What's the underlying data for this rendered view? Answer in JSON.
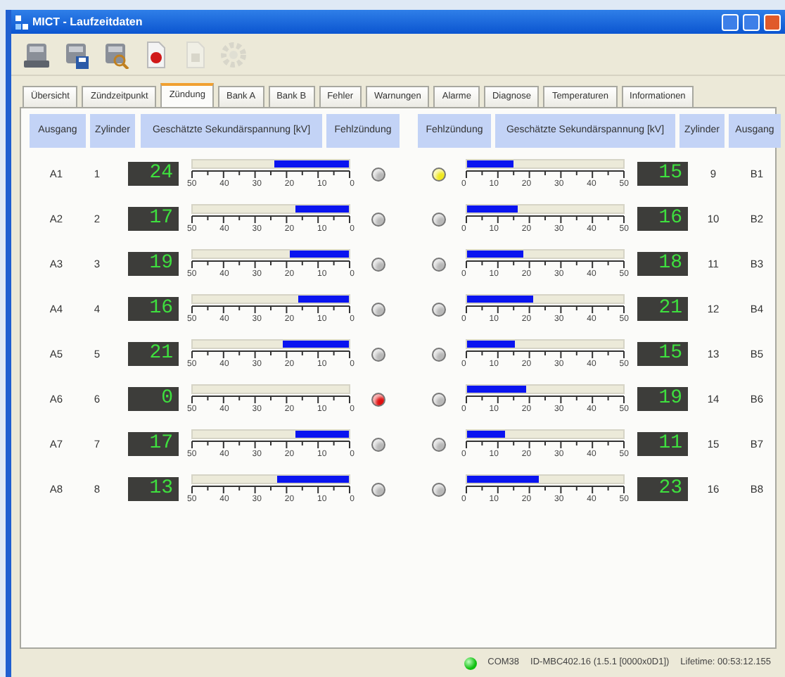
{
  "window": {
    "title": "MICT - Laufzeitdaten",
    "buttons": [
      {
        "kind": "minimize"
      },
      {
        "kind": "maximize"
      },
      {
        "kind": "close"
      }
    ]
  },
  "toolbar": [
    {
      "kind": "computer",
      "disabled": false
    },
    {
      "kind": "computer-save",
      "disabled": false
    },
    {
      "kind": "computer-search",
      "disabled": false
    },
    {
      "kind": "record",
      "disabled": false
    },
    {
      "kind": "stop",
      "disabled": true
    },
    {
      "kind": "gear",
      "disabled": true
    }
  ],
  "tabs": [
    {
      "label": "Übersicht",
      "selected": false
    },
    {
      "label": "Zündzeitpunkt",
      "selected": false
    },
    {
      "label": "Zündung",
      "selected": true
    },
    {
      "label": "Bank A",
      "selected": false
    },
    {
      "label": "Bank B",
      "selected": false
    },
    {
      "label": "Fehler",
      "selected": false
    },
    {
      "label": "Warnungen",
      "selected": false
    },
    {
      "label": "Alarme",
      "selected": false
    },
    {
      "label": "Diagnose",
      "selected": false
    },
    {
      "label": "Temperaturen",
      "selected": false
    },
    {
      "label": "Informationen",
      "selected": false
    }
  ],
  "left": {
    "headers": [
      "Ausgang",
      "Zylinder",
      "Geschätzte Sekundärspannung [kV]",
      "Fehlzündung"
    ],
    "rows": [
      {
        "output": "A1",
        "cylinder": "1",
        "voltage": "24",
        "level": 0.48,
        "scale": [
          "50",
          "40",
          "30",
          "20",
          "10",
          "0"
        ],
        "color": "#b8b8b8"
      },
      {
        "output": "A2",
        "cylinder": "2",
        "voltage": "17",
        "level": 0.34,
        "scale": [
          "50",
          "40",
          "30",
          "20",
          "10",
          "0"
        ],
        "color": "#b8b8b8"
      },
      {
        "output": "A3",
        "cylinder": "3",
        "voltage": "19",
        "level": 0.38,
        "scale": [
          "50",
          "40",
          "30",
          "20",
          "10",
          "0"
        ],
        "color": "#b8b8b8"
      },
      {
        "output": "A4",
        "cylinder": "4",
        "voltage": "16",
        "level": 0.32,
        "scale": [
          "50",
          "40",
          "30",
          "20",
          "10",
          "0"
        ],
        "color": "#b8b8b8"
      },
      {
        "output": "A5",
        "cylinder": "5",
        "voltage": "21",
        "level": 0.42,
        "scale": [
          "50",
          "40",
          "30",
          "20",
          "10",
          "0"
        ],
        "color": "#b8b8b8"
      },
      {
        "output": "A6",
        "cylinder": "6",
        "voltage": "0",
        "level": 0,
        "scale": [
          "50",
          "40",
          "30",
          "20",
          "10",
          "0"
        ],
        "color": "#e01010"
      },
      {
        "output": "A7",
        "cylinder": "7",
        "voltage": "17",
        "level": 0.34,
        "scale": [
          "50",
          "40",
          "30",
          "20",
          "10",
          "0"
        ],
        "color": "#b8b8b8"
      },
      {
        "output": "A8",
        "cylinder": "8",
        "voltage": "13",
        "level": 0.46,
        "scale": [
          "50",
          "40",
          "30",
          "20",
          "10",
          "0"
        ],
        "color": "#b8b8b8"
      }
    ]
  },
  "right": {
    "headers": [
      "Fehlzündung",
      "Geschätzte Sekundärspannung [kV]",
      "Zylinder",
      "Ausgang"
    ],
    "rows": [
      {
        "output": "B1",
        "cylinder": "9",
        "voltage": "15",
        "level": 0.3,
        "scale": [
          "0",
          "10",
          "20",
          "30",
          "40",
          "50"
        ],
        "color": "#f0e820"
      },
      {
        "output": "B2",
        "cylinder": "10",
        "voltage": "16",
        "level": 0.32,
        "scale": [
          "0",
          "10",
          "20",
          "30",
          "40",
          "50"
        ],
        "color": "#b8b8b8"
      },
      {
        "output": "B3",
        "cylinder": "11",
        "voltage": "18",
        "level": 0.36,
        "scale": [
          "0",
          "10",
          "20",
          "30",
          "40",
          "50"
        ],
        "color": "#b8b8b8"
      },
      {
        "output": "B4",
        "cylinder": "12",
        "voltage": "21",
        "level": 0.42,
        "scale": [
          "0",
          "10",
          "20",
          "30",
          "40",
          "50"
        ],
        "color": "#b8b8b8"
      },
      {
        "output": "B5",
        "cylinder": "13",
        "voltage": "15",
        "level": 0.31,
        "scale": [
          "0",
          "10",
          "20",
          "30",
          "40",
          "50"
        ],
        "color": "#b8b8b8"
      },
      {
        "output": "B6",
        "cylinder": "14",
        "voltage": "19",
        "level": 0.38,
        "scale": [
          "0",
          "10",
          "20",
          "30",
          "40",
          "50"
        ],
        "color": "#b8b8b8"
      },
      {
        "output": "B7",
        "cylinder": "15",
        "voltage": "11",
        "level": 0.24,
        "scale": [
          "0",
          "10",
          "20",
          "30",
          "40",
          "50"
        ],
        "color": "#b8b8b8"
      },
      {
        "output": "B8",
        "cylinder": "16",
        "voltage": "23",
        "level": 0.46,
        "scale": [
          "0",
          "10",
          "20",
          "30",
          "40",
          "50"
        ],
        "color": "#b8b8b8"
      }
    ]
  },
  "status_bar": {
    "online": true,
    "port": "COM38",
    "device": "ID-MBC402.16 (1.5.1 [0000x0D1])",
    "lifetime": "Lifetime: 00:53:12.155"
  }
}
